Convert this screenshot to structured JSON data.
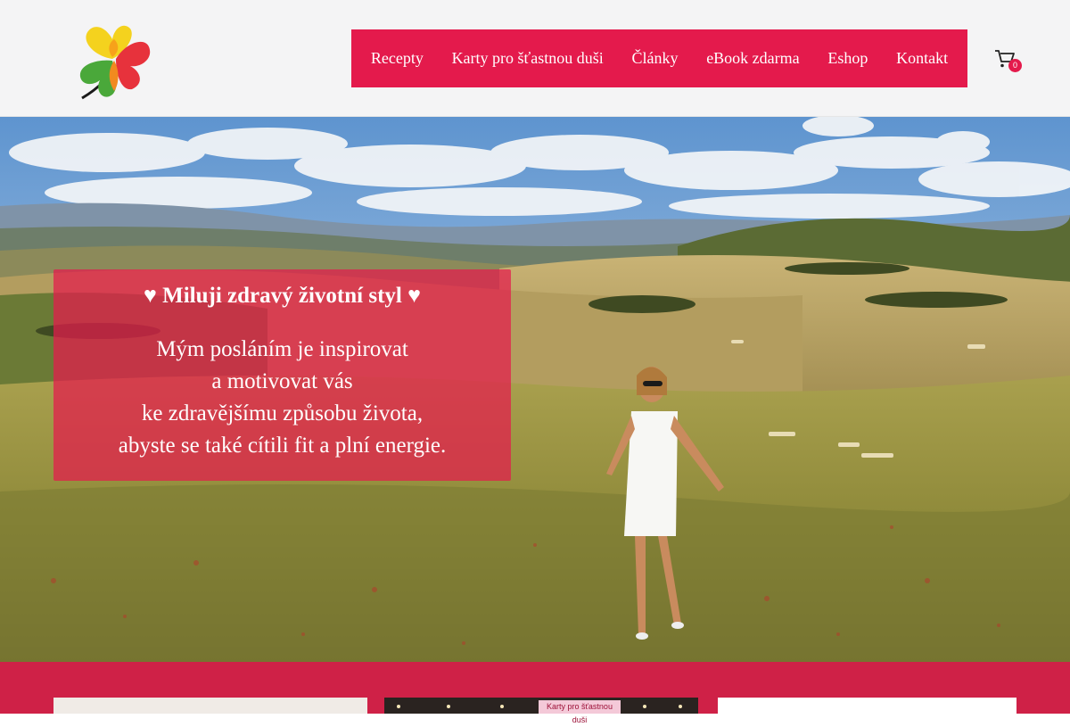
{
  "nav": {
    "items": [
      {
        "label": "Recepty"
      },
      {
        "label": "Karty pro šťastnou duši"
      },
      {
        "label": "Články"
      },
      {
        "label": "eBook zdarma"
      },
      {
        "label": "Eshop"
      },
      {
        "label": "Kontakt"
      }
    ]
  },
  "cart": {
    "count": "0",
    "icon": "cart-icon"
  },
  "logo": {
    "icon": "four-leaf-clover-logo"
  },
  "hero": {
    "title": "♥ Miluji zdravý životní styl ♥",
    "lines": [
      "Mým posláním je inspirovat",
      "a motivovat vás",
      "ke zdravějšímu způsobu života,",
      "abyste se také cítili fit a plní energie."
    ]
  },
  "cards": {
    "second_label": "Karty pro šťastnou duši"
  },
  "colors": {
    "accent": "#e41a4c",
    "band": "#cf2147"
  }
}
